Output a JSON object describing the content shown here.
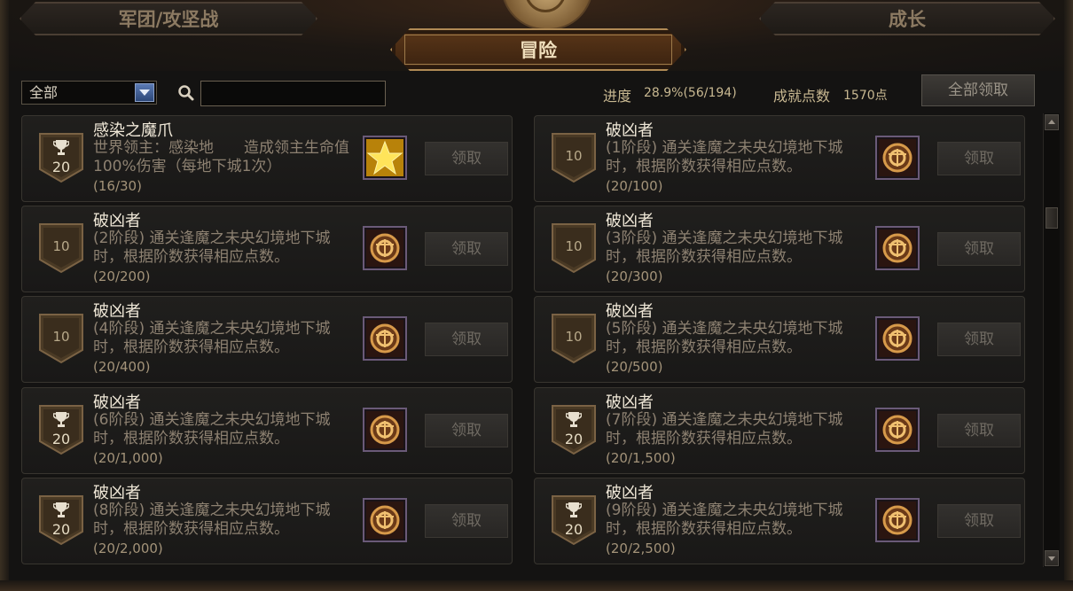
{
  "tabs": {
    "left": "军团/攻坚战",
    "center": "冒险",
    "right": "成长"
  },
  "filter": {
    "selected": "全部",
    "search_value": ""
  },
  "stats": {
    "progress_label": "进度",
    "progress_value": "28.9%(56/194)",
    "points_label": "成就点数",
    "points_value": "1570点"
  },
  "claim_all_label": "全部领取",
  "claim_label": "领取",
  "colors": {
    "accent_gold": "#b08a55",
    "text_title": "#f0e8d8",
    "text_desc": "#8d8171"
  },
  "achievements": [
    {
      "title": "感染之魔爪",
      "desc": "世界领主：感染地　　造成领主生命值100%伤害（每地下城1次）",
      "progress": "(16/30)",
      "points": "20",
      "badge": "trophy",
      "reward": "gold-star-icon"
    },
    {
      "title": "破凶者",
      "desc": "(1阶段) 通关逢魔之未央幻境地下城时，根据阶数获得相应点数。",
      "progress": "(20/100)",
      "points": "10",
      "badge": "plain",
      "reward": "ring-emblem-icon"
    },
    {
      "title": "破凶者",
      "desc": "(2阶段) 通关逢魔之未央幻境地下城时，根据阶数获得相应点数。",
      "progress": "(20/200)",
      "points": "10",
      "badge": "plain",
      "reward": "ring-emblem-icon"
    },
    {
      "title": "破凶者",
      "desc": "(3阶段) 通关逢魔之未央幻境地下城时，根据阶数获得相应点数。",
      "progress": "(20/300)",
      "points": "10",
      "badge": "plain",
      "reward": "ring-emblem-icon"
    },
    {
      "title": "破凶者",
      "desc": "(4阶段) 通关逢魔之未央幻境地下城时，根据阶数获得相应点数。",
      "progress": "(20/400)",
      "points": "10",
      "badge": "plain",
      "reward": "ring-emblem-icon"
    },
    {
      "title": "破凶者",
      "desc": "(5阶段) 通关逢魔之未央幻境地下城时，根据阶数获得相应点数。",
      "progress": "(20/500)",
      "points": "10",
      "badge": "plain",
      "reward": "ring-emblem-icon"
    },
    {
      "title": "破凶者",
      "desc": "(6阶段) 通关逢魔之未央幻境地下城时，根据阶数获得相应点数。",
      "progress": "(20/1,000)",
      "points": "20",
      "badge": "trophy",
      "reward": "ring-emblem-icon"
    },
    {
      "title": "破凶者",
      "desc": "(7阶段) 通关逢魔之未央幻境地下城时，根据阶数获得相应点数。",
      "progress": "(20/1,500)",
      "points": "20",
      "badge": "trophy",
      "reward": "ring-emblem-icon"
    },
    {
      "title": "破凶者",
      "desc": "(8阶段) 通关逢魔之未央幻境地下城时，根据阶数获得相应点数。",
      "progress": "(20/2,000)",
      "points": "20",
      "badge": "trophy",
      "reward": "ring-emblem-icon"
    },
    {
      "title": "破凶者",
      "desc": "(9阶段) 通关逢魔之未央幻境地下城时，根据阶数获得相应点数。",
      "progress": "(20/2,500)",
      "points": "20",
      "badge": "trophy",
      "reward": "ring-emblem-icon"
    }
  ]
}
